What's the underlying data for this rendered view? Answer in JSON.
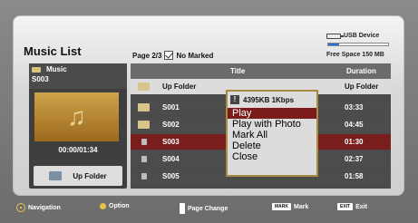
{
  "page": {
    "title": "Music List",
    "page_info": "Page 2/3",
    "marked": "No Marked"
  },
  "usb": {
    "label": "USB Device",
    "free_space": "Free Space 150 MB",
    "used_fraction": 0.18,
    "accent": "#2d6fd1"
  },
  "left_panel": {
    "category": "Music",
    "current": "S003",
    "time": "00:00/01:34",
    "up_folder": "Up Folder"
  },
  "table": {
    "header_title": "Title",
    "header_duration": "Duration",
    "rows": [
      {
        "name": "Up Folder",
        "duration": "Up Folder",
        "icon": "folder-up-icon",
        "style": "light"
      },
      {
        "name": "S001",
        "duration": "03:33",
        "icon": "folder-icon",
        "style": "dark"
      },
      {
        "name": "S002",
        "duration": "04:45",
        "icon": "folder-icon",
        "style": "dark"
      },
      {
        "name": "S003",
        "duration": "01:30",
        "icon": "music-file-icon",
        "style": "selected"
      },
      {
        "name": "S004",
        "duration": "02:37",
        "icon": "music-file-icon",
        "style": "dark"
      },
      {
        "name": "S005",
        "duration": "01:58",
        "icon": "music-file-icon",
        "style": "dark"
      }
    ]
  },
  "popup": {
    "info": "4395KB 1Kbps",
    "items": [
      "Play",
      "Play with Photo",
      "Mark All",
      "Delete",
      "Close"
    ],
    "active_index": 0,
    "accent": "#7b1b1b"
  },
  "footer": {
    "navigation": "Navigation",
    "option": "Option",
    "page_change": "Page Change",
    "mark_key": "MARK",
    "mark": "Mark",
    "exit_key": "EXIT",
    "exit": "Exit"
  }
}
